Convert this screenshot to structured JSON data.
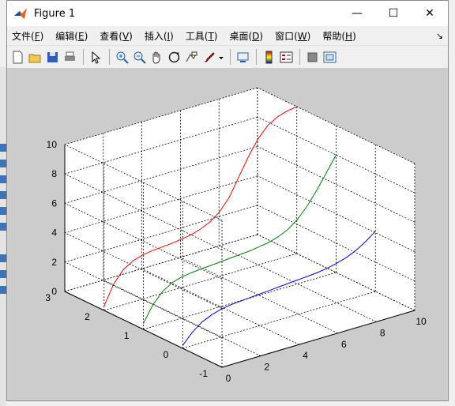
{
  "window": {
    "title": "Figure 1"
  },
  "window_controls": {
    "minimize": "—",
    "maximize": "☐",
    "close": "✕"
  },
  "menu": {
    "items": [
      {
        "label": "文件(",
        "key": "F",
        "end": ")"
      },
      {
        "label": "编辑(",
        "key": "E",
        "end": ")"
      },
      {
        "label": "查看(",
        "key": "V",
        "end": ")"
      },
      {
        "label": "插入(",
        "key": "I",
        "end": ")"
      },
      {
        "label": "工具(",
        "key": "T",
        "end": ")"
      },
      {
        "label": "桌面(",
        "key": "D",
        "end": ")"
      },
      {
        "label": "窗口(",
        "key": "W",
        "end": ")"
      },
      {
        "label": "帮助(",
        "key": "H",
        "end": ")"
      }
    ]
  },
  "toolbar": {
    "icons": [
      "new-figure-icon",
      "open-file-icon",
      "save-icon",
      "print-icon",
      "edit-plot-icon",
      "zoom-in-icon",
      "zoom-out-icon",
      "pan-icon",
      "rotate-3d-icon",
      "data-cursor-icon",
      "brush-icon",
      "brush-dropdown-icon",
      "link-plot-icon",
      "colorbar-icon",
      "legend-icon",
      "hide-plot-tools-icon",
      "show-plot-tools-icon"
    ]
  },
  "chart_data": {
    "type": "line",
    "projection": "3d",
    "grid": true,
    "xlim": [
      0,
      10
    ],
    "ylim": [
      -1,
      3
    ],
    "zlim": [
      0,
      10
    ],
    "xticks": [
      0,
      2,
      4,
      6,
      8,
      10
    ],
    "yticks": [
      -1,
      0,
      1,
      2,
      3
    ],
    "zticks": [
      0,
      2,
      4,
      6,
      8,
      10
    ],
    "xlabel": "",
    "ylabel": "",
    "zlabel": "",
    "title": "",
    "series": [
      {
        "color": "#0000ff",
        "y": 0,
        "x": [
          0,
          0.5,
          1,
          1.5,
          2,
          2.5,
          3,
          3.5,
          4,
          4.5,
          5,
          5.5,
          6,
          6.5,
          7,
          7.5,
          8,
          8.5,
          9,
          9.5,
          10
        ],
        "z": [
          0.2,
          0.9,
          1.4,
          1.7,
          1.9,
          2.0,
          2.05,
          2.1,
          2.15,
          2.2,
          2.25,
          2.3,
          2.35,
          2.4,
          2.45,
          2.55,
          2.7,
          2.9,
          3.2,
          3.6,
          4.1
        ]
      },
      {
        "color": "#008000",
        "y": 1,
        "x": [
          0,
          0.5,
          1,
          1.5,
          2,
          2.5,
          3,
          3.5,
          4,
          4.5,
          5,
          5.5,
          6,
          6.5,
          7,
          7.5,
          8,
          8.5,
          9,
          9.5,
          10
        ],
        "z": [
          0.4,
          1.5,
          2.2,
          2.6,
          2.8,
          2.9,
          2.95,
          3.0,
          3.05,
          3.1,
          3.15,
          3.2,
          3.3,
          3.4,
          3.6,
          3.9,
          4.4,
          5.1,
          6.0,
          7.0,
          8.0
        ]
      },
      {
        "color": "#ff0000",
        "y": 2,
        "x": [
          0,
          0.5,
          1,
          1.5,
          2,
          2.5,
          3,
          3.5,
          4,
          4.5,
          5,
          5.5,
          6,
          6.5,
          7,
          7.5,
          8,
          8.5,
          9,
          9.5,
          10
        ],
        "z": [
          0.3,
          1.6,
          2.4,
          2.8,
          3.0,
          3.1,
          3.15,
          3.2,
          3.3,
          3.4,
          3.6,
          3.9,
          4.4,
          5.2,
          6.4,
          7.6,
          8.6,
          9.3,
          9.7,
          9.9,
          10.0
        ]
      }
    ]
  }
}
